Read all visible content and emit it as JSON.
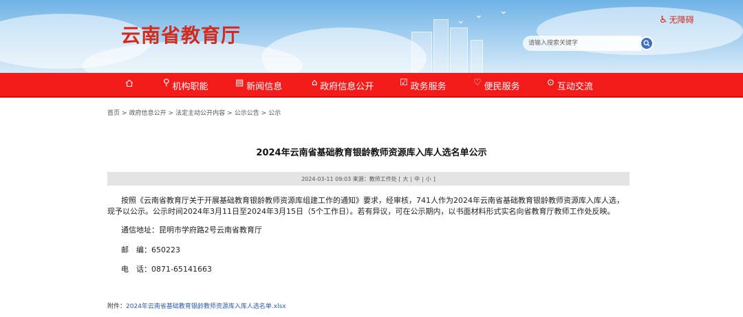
{
  "header": {
    "site_title": "云南省教育厅",
    "accessibility_label": "无障碍",
    "search_placeholder": "请输入搜索关键字"
  },
  "nav": {
    "items": [
      {
        "label": "机构职能",
        "icon": "org-icon"
      },
      {
        "label": "新闻信息",
        "icon": "news-icon"
      },
      {
        "label": "政府信息公开",
        "icon": "gov-icon"
      },
      {
        "label": "政务服务",
        "icon": "service-icon"
      },
      {
        "label": "便民服务",
        "icon": "heart-icon"
      },
      {
        "label": "互动交流",
        "icon": "chat-icon"
      }
    ]
  },
  "breadcrumb": [
    "首页",
    "政府信息公开",
    "法定主动公开内容",
    "公示公告",
    "公示"
  ],
  "article": {
    "title": "2024年云南省基础教育银龄教师资源库入库人选名单公示",
    "meta_prefix": "2024-03-11 09:03 来源：教师工作处 [",
    "font_large": "大",
    "font_medium": "中",
    "font_small": "小",
    "meta_suffix": "]",
    "paragraph": "按照《云南省教育厅关于开展基础教育银龄教师资源库组建工作的通知》要求，经审核，741人作为2024年云南省基础教育银龄教师资源库入库人选，现予以公示。公示时间2024年3月11日至2024年3月15日（5个工作日）。若有异议，可在公示期内，以书面材料形式实名向省教育厅教师工作处反映。",
    "address": "通信地址：昆明市学府路2号云南省教育厅",
    "postcode": "邮　编：650223",
    "phone": "电　话：0871-65141663",
    "attachment_label": "附件：",
    "attachment_link": "2024年云南省基础教育银龄教师资源库入库人选名单.xlsx"
  },
  "colors": {
    "nav_red": "#f41b1b",
    "title_red": "#d42a1c",
    "link_blue": "#2a5db0"
  }
}
